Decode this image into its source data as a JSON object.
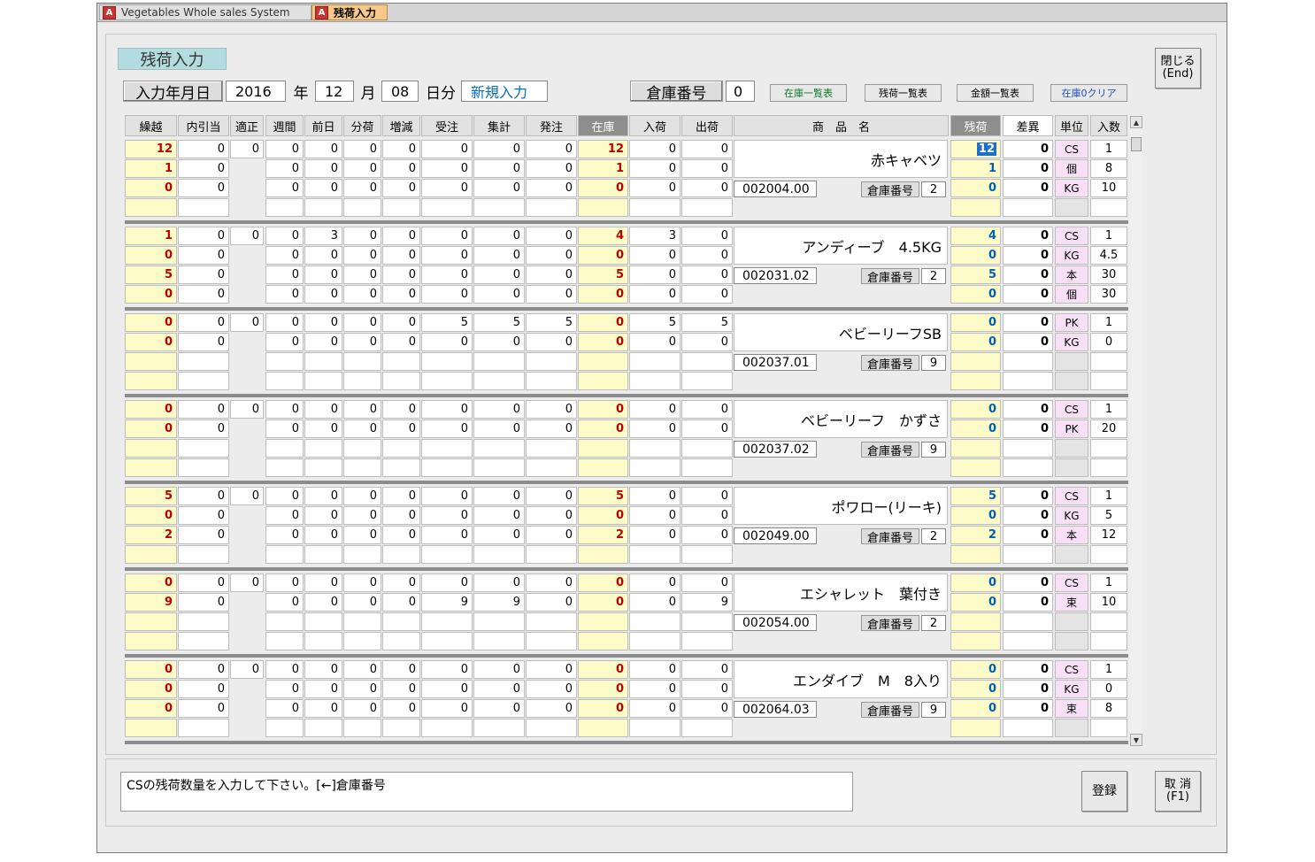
{
  "tabs": [
    {
      "icon": "access-form-icon",
      "label": "Vegetables Whole sales System"
    },
    {
      "icon": "access-form-icon",
      "label": "残荷入力"
    }
  ],
  "form_title": "残荷入力",
  "date": {
    "label": "入力年月日",
    "year": "2016",
    "year_unit": "年",
    "month": "12",
    "month_unit": "月",
    "day": "08",
    "day_unit": "日分",
    "mode": "新規入力"
  },
  "warehouse": {
    "label": "倉庫番号",
    "value": "0"
  },
  "buttons": {
    "stock_list": "在庫一覧表",
    "remain_list": "残荷一覧表",
    "amount_list": "金額一覧表",
    "stock_clear": "在庫0クリア",
    "close": "閉じる",
    "close_key": "(End)",
    "register": "登録",
    "cancel": "取 消",
    "cancel_key": "(F1)"
  },
  "columns": [
    "繰越",
    "内引当",
    "適正",
    "週間",
    "前日",
    "分荷",
    "増減",
    "受注",
    "集計",
    "発注",
    "在庫",
    "入荷",
    "出荷",
    "商　品　名",
    "残荷",
    "差異",
    "単位",
    "入数"
  ],
  "product_code_label": "倉庫番号",
  "products": [
    {
      "name": "赤キャベツ",
      "code": "002004.00",
      "wh": "2",
      "tekisei": "0",
      "rows": [
        {
          "kurikoshi": "12",
          "uchi": "0",
          "shukan": "0",
          "zenjitsu": "0",
          "bunka": "0",
          "zogen": "0",
          "juchu": "0",
          "shukei": "0",
          "hatchu": "0",
          "zaiko": "12",
          "nyuka": "0",
          "shukka": "0",
          "zanka": "12",
          "sai": "0",
          "unit": "CS",
          "irisu": "1"
        },
        {
          "kurikoshi": "1",
          "uchi": "0",
          "shukan": "0",
          "zenjitsu": "0",
          "bunka": "0",
          "zogen": "0",
          "juchu": "0",
          "shukei": "0",
          "hatchu": "0",
          "zaiko": "1",
          "nyuka": "0",
          "shukka": "0",
          "zanka": "1",
          "sai": "0",
          "unit": "個",
          "irisu": "8"
        },
        {
          "kurikoshi": "0",
          "uchi": "0",
          "shukan": "0",
          "zenjitsu": "0",
          "bunka": "0",
          "zogen": "0",
          "juchu": "0",
          "shukei": "0",
          "hatchu": "0",
          "zaiko": "0",
          "nyuka": "0",
          "shukka": "0",
          "zanka": "0",
          "sai": "0",
          "unit": "KG",
          "irisu": "10"
        }
      ]
    },
    {
      "name": "アンディーブ　4.5KG",
      "code": "002031.02",
      "wh": "2",
      "tekisei": "0",
      "rows": [
        {
          "kurikoshi": "1",
          "uchi": "0",
          "shukan": "0",
          "zenjitsu": "3",
          "bunka": "0",
          "zogen": "0",
          "juchu": "0",
          "shukei": "0",
          "hatchu": "0",
          "zaiko": "4",
          "nyuka": "3",
          "shukka": "0",
          "zanka": "4",
          "sai": "0",
          "unit": "CS",
          "irisu": "1"
        },
        {
          "kurikoshi": "0",
          "uchi": "0",
          "shukan": "0",
          "zenjitsu": "0",
          "bunka": "0",
          "zogen": "0",
          "juchu": "0",
          "shukei": "0",
          "hatchu": "0",
          "zaiko": "0",
          "nyuka": "0",
          "shukka": "0",
          "zanka": "0",
          "sai": "0",
          "unit": "KG",
          "irisu": "4.5"
        },
        {
          "kurikoshi": "5",
          "uchi": "0",
          "shukan": "0",
          "zenjitsu": "0",
          "bunka": "0",
          "zogen": "0",
          "juchu": "0",
          "shukei": "0",
          "hatchu": "0",
          "zaiko": "5",
          "nyuka": "0",
          "shukka": "0",
          "zanka": "5",
          "sai": "0",
          "unit": "本",
          "irisu": "30"
        },
        {
          "kurikoshi": "0",
          "uchi": "0",
          "shukan": "0",
          "zenjitsu": "0",
          "bunka": "0",
          "zogen": "0",
          "juchu": "0",
          "shukei": "0",
          "hatchu": "0",
          "zaiko": "0",
          "nyuka": "0",
          "shukka": "0",
          "zanka": "0",
          "sai": "0",
          "unit": "個",
          "irisu": "30"
        }
      ]
    },
    {
      "name": "ベビーリーフSB",
      "code": "002037.01",
      "wh": "9",
      "tekisei": "0",
      "rows": [
        {
          "kurikoshi": "0",
          "uchi": "0",
          "shukan": "0",
          "zenjitsu": "0",
          "bunka": "0",
          "zogen": "0",
          "juchu": "5",
          "shukei": "5",
          "hatchu": "5",
          "zaiko": "0",
          "nyuka": "5",
          "shukka": "5",
          "zanka": "0",
          "sai": "0",
          "unit": "PK",
          "irisu": "1"
        },
        {
          "kurikoshi": "0",
          "uchi": "0",
          "shukan": "0",
          "zenjitsu": "0",
          "bunka": "0",
          "zogen": "0",
          "juchu": "0",
          "shukei": "0",
          "hatchu": "0",
          "zaiko": "0",
          "nyuka": "0",
          "shukka": "0",
          "zanka": "0",
          "sai": "0",
          "unit": "KG",
          "irisu": "0"
        }
      ]
    },
    {
      "name": "ベビーリーフ　かずさ",
      "code": "002037.02",
      "wh": "9",
      "tekisei": "0",
      "rows": [
        {
          "kurikoshi": "0",
          "uchi": "0",
          "shukan": "0",
          "zenjitsu": "0",
          "bunka": "0",
          "zogen": "0",
          "juchu": "0",
          "shukei": "0",
          "hatchu": "0",
          "zaiko": "0",
          "nyuka": "0",
          "shukka": "0",
          "zanka": "0",
          "sai": "0",
          "unit": "CS",
          "irisu": "1"
        },
        {
          "kurikoshi": "0",
          "uchi": "0",
          "shukan": "0",
          "zenjitsu": "0",
          "bunka": "0",
          "zogen": "0",
          "juchu": "0",
          "shukei": "0",
          "hatchu": "0",
          "zaiko": "0",
          "nyuka": "0",
          "shukka": "0",
          "zanka": "0",
          "sai": "0",
          "unit": "PK",
          "irisu": "20"
        }
      ]
    },
    {
      "name": "ポワロー(リーキ)",
      "code": "002049.00",
      "wh": "2",
      "tekisei": "0",
      "rows": [
        {
          "kurikoshi": "5",
          "uchi": "0",
          "shukan": "0",
          "zenjitsu": "0",
          "bunka": "0",
          "zogen": "0",
          "juchu": "0",
          "shukei": "0",
          "hatchu": "0",
          "zaiko": "5",
          "nyuka": "0",
          "shukka": "0",
          "zanka": "5",
          "sai": "0",
          "unit": "CS",
          "irisu": "1"
        },
        {
          "kurikoshi": "0",
          "uchi": "0",
          "shukan": "0",
          "zenjitsu": "0",
          "bunka": "0",
          "zogen": "0",
          "juchu": "0",
          "shukei": "0",
          "hatchu": "0",
          "zaiko": "0",
          "nyuka": "0",
          "shukka": "0",
          "zanka": "0",
          "sai": "0",
          "unit": "KG",
          "irisu": "5"
        },
        {
          "kurikoshi": "2",
          "uchi": "0",
          "shukan": "0",
          "zenjitsu": "0",
          "bunka": "0",
          "zogen": "0",
          "juchu": "0",
          "shukei": "0",
          "hatchu": "0",
          "zaiko": "2",
          "nyuka": "0",
          "shukka": "0",
          "zanka": "2",
          "sai": "0",
          "unit": "本",
          "irisu": "12"
        }
      ]
    },
    {
      "name": "エシャレット　葉付き",
      "code": "002054.00",
      "wh": "2",
      "tekisei": "0",
      "rows": [
        {
          "kurikoshi": "0",
          "uchi": "0",
          "shukan": "0",
          "zenjitsu": "0",
          "bunka": "0",
          "zogen": "0",
          "juchu": "0",
          "shukei": "0",
          "hatchu": "0",
          "zaiko": "0",
          "nyuka": "0",
          "shukka": "0",
          "zanka": "0",
          "sai": "0",
          "unit": "CS",
          "irisu": "1"
        },
        {
          "kurikoshi": "9",
          "uchi": "0",
          "shukan": "0",
          "zenjitsu": "0",
          "bunka": "0",
          "zogen": "0",
          "juchu": "9",
          "shukei": "9",
          "hatchu": "0",
          "zaiko": "0",
          "nyuka": "0",
          "shukka": "9",
          "zanka": "0",
          "sai": "0",
          "unit": "束",
          "irisu": "10"
        }
      ]
    },
    {
      "name": "エンダイブ　M　8入り",
      "code": "002064.03",
      "wh": "9",
      "tekisei": "0",
      "rows": [
        {
          "kurikoshi": "0",
          "uchi": "0",
          "shukan": "0",
          "zenjitsu": "0",
          "bunka": "0",
          "zogen": "0",
          "juchu": "0",
          "shukei": "0",
          "hatchu": "0",
          "zaiko": "0",
          "nyuka": "0",
          "shukka": "0",
          "zanka": "0",
          "sai": "0",
          "unit": "CS",
          "irisu": "1"
        },
        {
          "kurikoshi": "0",
          "uchi": "0",
          "shukan": "0",
          "zenjitsu": "0",
          "bunka": "0",
          "zogen": "0",
          "juchu": "0",
          "shukei": "0",
          "hatchu": "0",
          "zaiko": "0",
          "nyuka": "0",
          "shukka": "0",
          "zanka": "0",
          "sai": "0",
          "unit": "KG",
          "irisu": "0"
        },
        {
          "kurikoshi": "0",
          "uchi": "0",
          "shukan": "0",
          "zenjitsu": "0",
          "bunka": "0",
          "zogen": "0",
          "juchu": "0",
          "shukei": "0",
          "hatchu": "0",
          "zaiko": "0",
          "nyuka": "0",
          "shukka": "0",
          "zanka": "0",
          "sai": "0",
          "unit": "束",
          "irisu": "8"
        }
      ]
    }
  ],
  "scroll_icons": {
    "up": "scroll-up-arrow-icon",
    "down": "scroll-down-arrow-icon"
  },
  "status_message": "CSの残荷数量を入力して下さい。[←]倉庫番号"
}
